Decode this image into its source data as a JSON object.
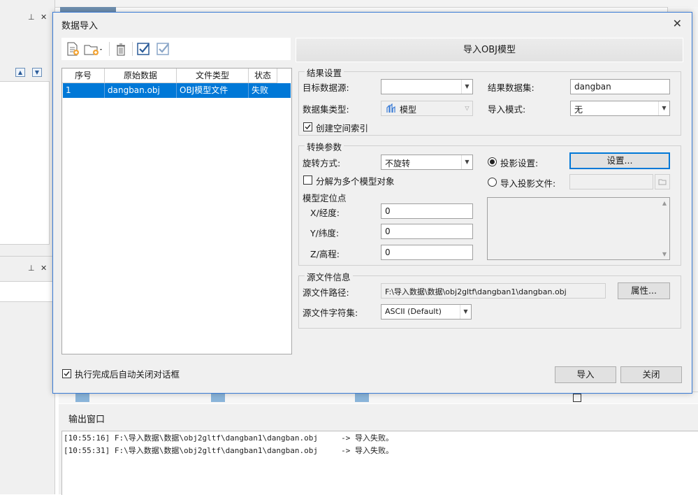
{
  "output_window": {
    "title": "输出窗口",
    "log": [
      "[10:55:16] F:\\导入数据\\数据\\obj2gltf\\dangban1\\dangban.obj     -> 导入失败。",
      "[10:55:31] F:\\导入数据\\数据\\obj2gltf\\dangban1\\dangban.obj     -> 导入失败。"
    ]
  },
  "background": {
    "pin_glyph": "⊥",
    "close_glyph": "✕"
  },
  "dialog": {
    "title": "数据导入",
    "close_glyph": "✕",
    "toolbar": {
      "icons": [
        "add-file-icon",
        "add-folder-icon",
        "delete-icon",
        "select-all-icon",
        "select-invert-icon"
      ]
    },
    "list": {
      "columns": [
        "序号",
        "原始数据",
        "文件类型",
        "状态"
      ],
      "rows": [
        {
          "index": "1",
          "source": "dangban.obj",
          "type": "OBJ模型文件",
          "status": "失败"
        }
      ]
    },
    "header": "导入OBJ模型",
    "result": {
      "group_title": "结果设置",
      "target_source_label": "目标数据源:",
      "target_source_value": "",
      "result_dataset_label": "结果数据集:",
      "result_dataset_value": "dangban",
      "dataset_type_label": "数据集类型:",
      "dataset_type_value": "模型",
      "import_mode_label": "导入模式:",
      "import_mode_value": "无",
      "spatial_index_label": "创建空间索引",
      "spatial_index_checked": true
    },
    "convert": {
      "group_title": "转换参数",
      "rotation_label": "旋转方式:",
      "rotation_value": "不旋转",
      "projection_setting_label": "投影设置:",
      "projection_setting_button": "设置...",
      "split_label": "分解为多个模型对象",
      "import_projection_label": "导入投影文件:",
      "position_label": "模型定位点",
      "x_label": "X/经度:",
      "x_value": "0",
      "y_label": "Y/纬度:",
      "y_value": "0",
      "z_label": "Z/高程:",
      "z_value": "0"
    },
    "source": {
      "group_title": "源文件信息",
      "path_label": "源文件路径:",
      "path_value": "F:\\导入数据\\数据\\obj2gltf\\dangban1\\dangban.obj",
      "properties_button": "属性...",
      "charset_label": "源文件字符集:",
      "charset_value": "ASCII (Default)"
    },
    "auto_close_label": "执行完成后自动关闭对话框",
    "auto_close_checked": true,
    "import_button": "导入",
    "close_button": "关闭"
  }
}
